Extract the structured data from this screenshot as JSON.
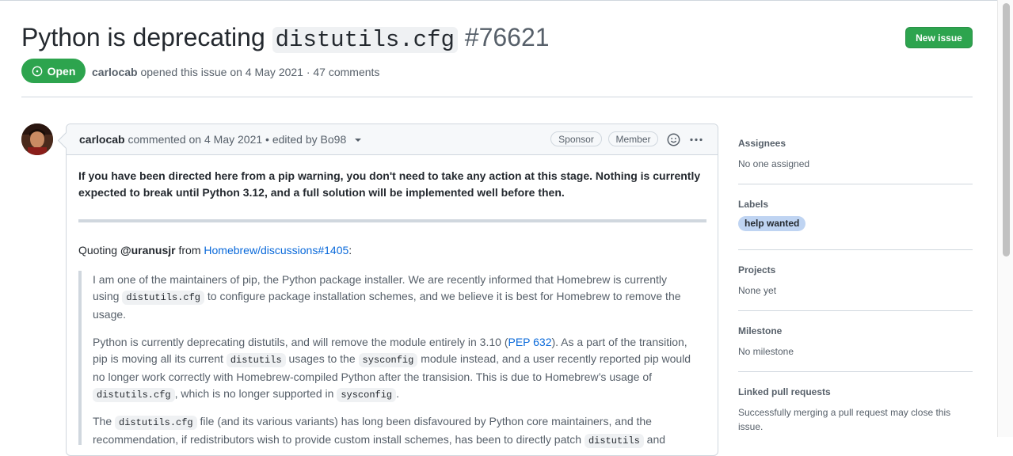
{
  "issue": {
    "title_prefix": "Python is deprecating",
    "title_code": "distutils.cfg",
    "number": "#76621",
    "new_issue_label": "New issue",
    "state": "Open",
    "author": "carlocab",
    "meta_rest": "opened this issue on 4 May 2021 · 47 comments"
  },
  "comment": {
    "author": "carlocab",
    "header_rest": "commented on 4 May 2021 • edited by Bo98",
    "badges": [
      "Sponsor",
      "Member"
    ],
    "notice": "If you have been directed here from a pip warning, you don't need to take any action at this stage. Nothing is currently expected to break until Python 3.12, and a full solution will be implemented well before then.",
    "quoting_prefix": "Quoting",
    "quoting_user": "@uranusjr",
    "quoting_from": "from",
    "quoting_link": "Homebrew/discussions#1405",
    "quoting_suffix": ":",
    "p1_a": "I am one of the maintainers of pip, the Python package installer. We are recently informed that Homebrew is currently using",
    "p1_code": "distutils.cfg",
    "p1_b": "to configure package installation schemes, and we believe it is best for Homebrew to remove the usage.",
    "p2_a": "Python is currently deprecating distutils, and will remove the module entirely in 3.10 (",
    "p2_link": "PEP 632",
    "p2_b": "). As a part of the transition, pip is moving all its current",
    "p2_code1": "distutils",
    "p2_c": "usages to the",
    "p2_code2": "sysconfig",
    "p2_d": "module instead, and a user recently reported pip would no longer work correctly with Homebrew-compiled Python after the transision. This is due to Homebrew’s usage of",
    "p2_code3": "distutils.cfg",
    "p2_e": ", which is no longer supported in",
    "p2_code4": "sysconfig",
    "p2_f": ".",
    "p3_a": "The",
    "p3_code1": "distutils.cfg",
    "p3_b": "file (and its various variants) has long been disfavoured by Python core maintainers, and the recommendation, if redistributors wish to provide custom install schemes, has been to directly patch",
    "p3_code2": "distutils",
    "p3_c": "and"
  },
  "sidebar": {
    "assignees_h": "Assignees",
    "assignees_v": "No one assigned",
    "labels_h": "Labels",
    "label": "help wanted",
    "projects_h": "Projects",
    "projects_v": "None yet",
    "milestone_h": "Milestone",
    "milestone_v": "No milestone",
    "linked_h": "Linked pull requests",
    "linked_v": "Successfully merging a pull request may close this issue."
  },
  "colors": {
    "open_green": "#2da44e",
    "link_blue": "#0969da",
    "label_bg": "#bfd4f2"
  }
}
